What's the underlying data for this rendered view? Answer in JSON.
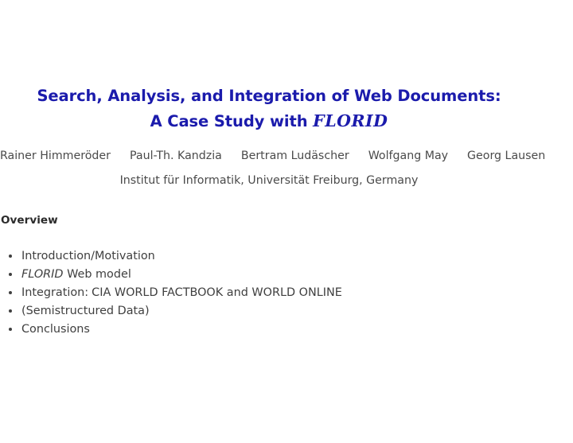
{
  "slide": {
    "background_color": "#ffffff",
    "title": {
      "color": "#1b1bac",
      "line1": "Search, Analysis, and Integration of Web Documents:",
      "line2_prefix": "A Case Study with ",
      "line2_emphasis": "FLORID"
    },
    "authors": [
      {
        "name": "Rainer Himmeröder"
      },
      {
        "name": "Paul-Th. Kandzia"
      },
      {
        "name": "Bertram Ludäscher"
      },
      {
        "name": "Wolfgang May"
      },
      {
        "name": "Georg Lausen"
      }
    ],
    "affiliation": "Institut für Informatik, Universität Freiburg, Germany",
    "overview": {
      "heading": "Overview",
      "items": [
        {
          "text": "Introduction/Motivation"
        },
        {
          "emphasis": "FLORID",
          "text": " Web model"
        },
        {
          "text": "Integration:",
          "text2": "CIA WORLD FACTBOOK and WORLD ONLINE"
        },
        {
          "text": "(Semistructured Data)"
        },
        {
          "text": "Conclusions"
        }
      ]
    }
  }
}
